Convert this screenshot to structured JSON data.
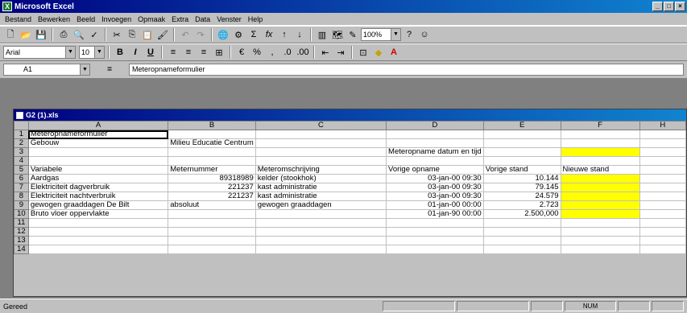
{
  "window": {
    "title": "Microsoft Excel"
  },
  "menu": [
    "Bestand",
    "Bewerken",
    "Beeld",
    "Invoegen",
    "Opmaak",
    "Extra",
    "Data",
    "Venster",
    "Help"
  ],
  "toolbar": {
    "zoom": "100%"
  },
  "format_bar": {
    "font": "Arial",
    "size": "10"
  },
  "formula_bar": {
    "cell_ref": "A1",
    "eq": "=",
    "content": "Meteropnameformulier"
  },
  "document": {
    "title": "G2 (1).xls"
  },
  "sheet": {
    "columns": [
      "A",
      "B",
      "C",
      "D",
      "E",
      "F",
      "H"
    ],
    "rows": [
      {
        "n": "1",
        "cells": [
          "Meteropnameformulier",
          "",
          "",
          "",
          "",
          "",
          ""
        ]
      },
      {
        "n": "2",
        "cells": [
          "Gebouw",
          "Milieu Educatie Centrum",
          "",
          "",
          "",
          "",
          ""
        ]
      },
      {
        "n": "3",
        "cells": [
          "",
          "",
          "",
          "Meteropname datum en tijd",
          "",
          "",
          ""
        ]
      },
      {
        "n": "4",
        "cells": [
          "",
          "",
          "",
          "",
          "",
          "",
          ""
        ]
      },
      {
        "n": "5",
        "cells": [
          "Variabele",
          "Meternummer",
          "Meteromschrijving",
          "Vorige opname",
          "Vorige stand",
          "Nieuwe stand",
          ""
        ]
      },
      {
        "n": "6",
        "cells": [
          "Aardgas",
          "89318989",
          "kelder (stookhok)",
          "03-jan-00 09:30",
          "10.144",
          "",
          ""
        ]
      },
      {
        "n": "7",
        "cells": [
          "Elektriciteit dagverbruik",
          "221237",
          "kast administratie",
          "03-jan-00 09:30",
          "79.145",
          "",
          ""
        ]
      },
      {
        "n": "8",
        "cells": [
          "Elektriciteit nachtverbruik",
          "221237",
          "kast administratie",
          "03-jan-00 09:30",
          "24.579",
          "",
          ""
        ]
      },
      {
        "n": "9",
        "cells": [
          "gewogen graaddagen De Bilt",
          "absoluut",
          "gewogen graaddagen",
          "01-jan-00 00:00",
          "2.723",
          "",
          ""
        ]
      },
      {
        "n": "10",
        "cells": [
          "Bruto vloer oppervlakte",
          "",
          "",
          "01-jan-90 00:00",
          "2.500,000",
          "",
          ""
        ]
      },
      {
        "n": "11",
        "cells": [
          "",
          "",
          "",
          "",
          "",
          "",
          ""
        ]
      },
      {
        "n": "12",
        "cells": [
          "",
          "",
          "",
          "",
          "",
          "",
          ""
        ]
      },
      {
        "n": "13",
        "cells": [
          "",
          "",
          "",
          "",
          "",
          "",
          ""
        ]
      },
      {
        "n": "14",
        "cells": [
          "",
          "",
          "",
          "",
          "",
          "",
          ""
        ]
      }
    ]
  },
  "status": {
    "mode": "Gereed",
    "num": "NUM"
  },
  "colors": {
    "highlight": "#ffff00",
    "titlebar": "#000080"
  }
}
